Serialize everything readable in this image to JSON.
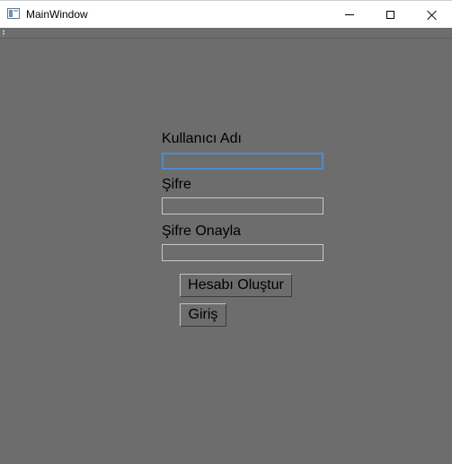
{
  "window": {
    "title": "MainWindow",
    "icons": [
      "app-icon",
      "minimize-icon",
      "maximize-icon",
      "close-icon"
    ]
  },
  "form": {
    "username_label": "Kullanıcı Adı",
    "username_value": "",
    "password_label": "Şifre",
    "password_value": "",
    "confirm_label": "Şifre Onayla",
    "confirm_value": "",
    "create_button": "Hesabı Oluştur",
    "login_button": "Giriş"
  },
  "colors": {
    "background": "#6d6d6d",
    "focus_border": "#4f8bc9"
  }
}
